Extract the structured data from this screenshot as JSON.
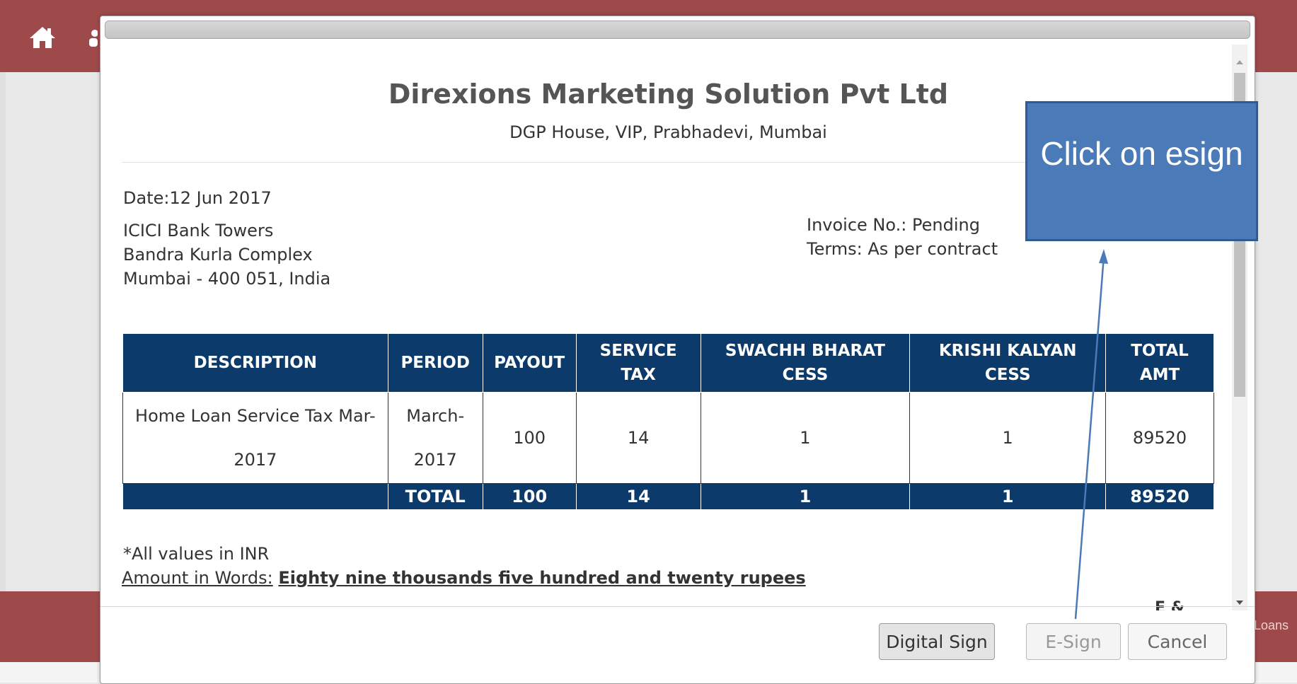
{
  "background": {
    "bottom_band_text": "Loans"
  },
  "invoice": {
    "company": "Direxions Marketing Solution Pvt Ltd",
    "address": "DGP House, VIP, Prabhadevi, Mumbai",
    "date": "Date:12 Jun 2017",
    "to_lines": [
      "ICICI Bank Towers",
      "Bandra Kurla Complex",
      "Mumbai - 400 051, India"
    ],
    "invoice_no": "Invoice No.: Pending",
    "terms": "Terms: As per contract",
    "table": {
      "headers": [
        "DESCRIPTION",
        "PERIOD",
        "PAYOUT",
        "SERVICE TAX",
        "SWACHH BHARAT CESS",
        "KRISHI KALYAN CESS",
        "TOTAL AMT"
      ],
      "row": [
        "Home Loan Service Tax Mar-2017",
        "March-2017",
        "100",
        "14",
        "1",
        "1",
        "89520"
      ],
      "total": [
        "",
        "TOTAL",
        "100",
        "14",
        "1",
        "1",
        "89520"
      ]
    },
    "inr_note": "*All values in INR",
    "amount_words_label": "Amount in Words:",
    "amount_words_value": "Eighty nine thousands five hundred and twenty rupees",
    "eoe": "E & O.E"
  },
  "buttons": {
    "digital_sign": "Digital Sign",
    "esign": "E-Sign",
    "cancel": "Cancel"
  },
  "annotation": {
    "text": "Click on esign"
  },
  "colors": {
    "header_band": "#9e4a4a",
    "table_header": "#0b3a6b",
    "callout": "#4a7ab8"
  }
}
